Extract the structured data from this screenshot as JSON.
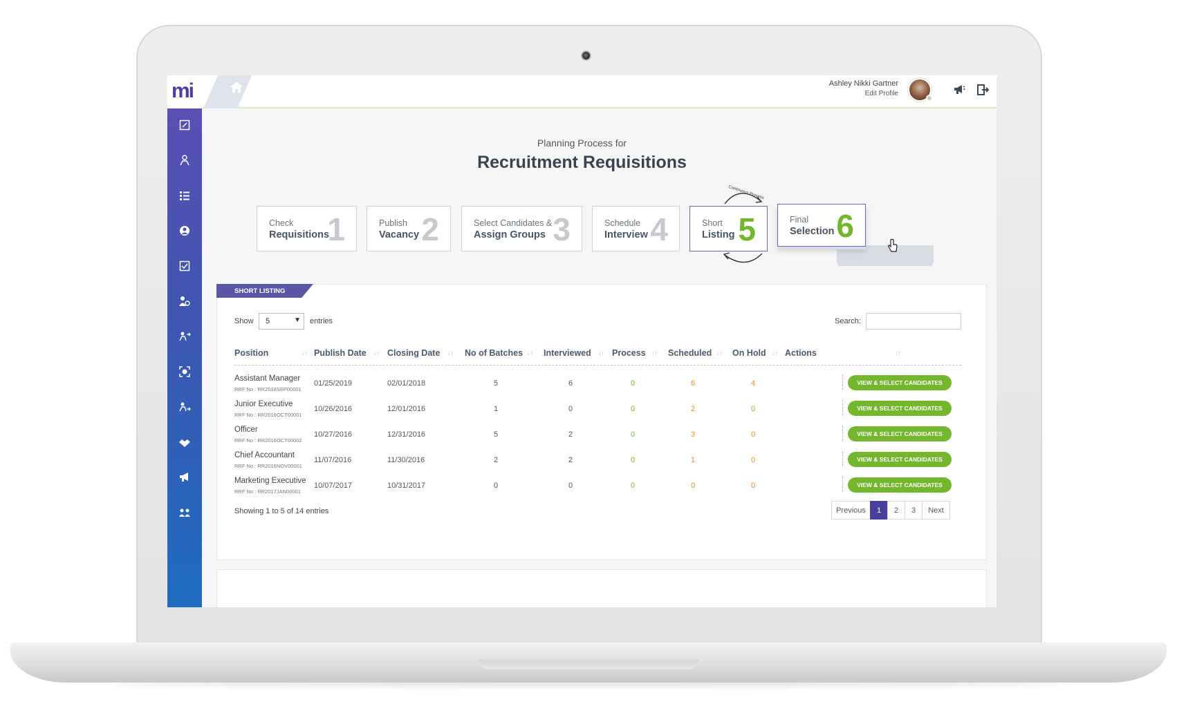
{
  "header": {
    "logo_text": "mi",
    "user_name": "Ashley Nikki Gartner",
    "edit_profile": "Edit Profile"
  },
  "sidebar": {
    "icons": [
      "document-edit-icon",
      "person-network-icon",
      "list-icon",
      "user-circle-icon",
      "document-check-icon",
      "person-settings-icon",
      "person-transfer-icon",
      "face-scan-icon",
      "person-transfer-2-icon",
      "handshake-icon",
      "megaphone-icon",
      "group-settings-icon"
    ]
  },
  "page": {
    "subtitle": "Planning Process for",
    "title": "Recruitment Requisitions"
  },
  "steps": [
    {
      "line1": "Check",
      "line2": "Requisitions",
      "num": "1"
    },
    {
      "line1": "Publish",
      "line2": "Vacancy",
      "num": "2"
    },
    {
      "line1": "Select Candidates &",
      "line2": "Assign Groups",
      "num": "3"
    },
    {
      "line1": "Schedule",
      "line2": "Interview",
      "num": "4"
    },
    {
      "line1": "Short",
      "line2": "Listing",
      "num": "5"
    },
    {
      "line1": "Final",
      "line2": "Selection",
      "num": "6"
    }
  ],
  "loop_label": "Continuous Process",
  "card": {
    "tab_label": "SHORT LISTING",
    "show_label": "Show",
    "show_value": "5",
    "entries_label": "entries",
    "search_label": "Search:",
    "columns": [
      "Position",
      "Publish Date",
      "Closing Date",
      "No of Batches",
      "Interviewed",
      "Process",
      "Scheduled",
      "On Hold",
      "Actions"
    ],
    "rows": [
      {
        "position": "Assistant Manager",
        "rrf": "RRF No : RR2018SEP00001",
        "publish": "01/25/2019",
        "closing": "02/01/2018",
        "batches": "5",
        "interviewed": "6",
        "process": "0",
        "scheduled": "6",
        "onhold": "4",
        "action": "VIEW & SELECT CANDIDATES"
      },
      {
        "position": "Junior Executive",
        "rrf": "RRF No : RR2016OCT00001",
        "publish": "10/26/2016",
        "closing": "12/01/2016",
        "batches": "1",
        "interviewed": "0",
        "process": "0",
        "scheduled": "2",
        "onhold": "0",
        "action": "VIEW & SELECT CANDIDATES"
      },
      {
        "position": "Officer",
        "rrf": "RRF No : RR2016OCT00002",
        "publish": "10/27/2016",
        "closing": "12/31/2016",
        "batches": "5",
        "interviewed": "2",
        "process": "0",
        "scheduled": "3",
        "onhold": "0",
        "action": "VIEW & SELECT CANDIDATES"
      },
      {
        "position": "Chief Accountant",
        "rrf": "RRF No : RR2016NOV00001",
        "publish": "11/07/2016",
        "closing": "11/30/2016",
        "batches": "2",
        "interviewed": "2",
        "process": "0",
        "scheduled": "1",
        "onhold": "0",
        "action": "VIEW & SELECT CANDIDATES"
      },
      {
        "position": "Marketing Executive",
        "rrf": "RRF No : RR2017JAN00001",
        "publish": "10/07/2017",
        "closing": "10/31/2017",
        "batches": "0",
        "interviewed": "0",
        "process": "0",
        "scheduled": "0",
        "onhold": "0",
        "action": "VIEW & SELECT CANDIDATES"
      }
    ],
    "showing_text": "Showing 1 to 5 of 14 entries",
    "pagination": {
      "previous": "Previous",
      "pages": [
        "1",
        "2",
        "3"
      ],
      "next": "Next",
      "current": "1"
    }
  },
  "colors": {
    "primary": "#4a3f9c",
    "accent_green": "#74b72e",
    "accent_orange": "#f08a2c"
  }
}
